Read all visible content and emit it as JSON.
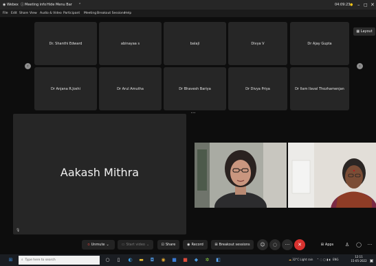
{
  "titlebar": {
    "items": [
      "Webex",
      "Meeting info",
      "Hide Menu Bar"
    ],
    "timer": "04:09:23",
    "minimize": "–",
    "restore": "◻",
    "close": "✕"
  },
  "menubar": {
    "items": [
      "File",
      "Edit",
      "Share",
      "View",
      "Audio & Video",
      "Participant",
      "Meeting",
      "Breakout Sessions",
      "Help"
    ]
  },
  "gallery": {
    "row1": [
      "Dr. Shanthi Edward",
      "abinayaa s",
      "balaji",
      "Divya V",
      "Dr Ajay Gupta"
    ],
    "row2": [
      "Dr Anjana R.Joshi",
      "Dr Arul Amutha",
      "Dr Bhavesh Bariya",
      "Dr Divya Priya",
      "Dr Ilam Ilaval Thozhamenjan"
    ],
    "layout_label": "Layout"
  },
  "main_speaker": {
    "name": "Aakash Mithra"
  },
  "controls": {
    "unmute": "Unmute",
    "start_video": "Start video",
    "share": "Share",
    "record": "Record",
    "breakout": "Breakout sessions",
    "apps": "Apps"
  },
  "taskbar": {
    "search_placeholder": "Type here to search",
    "weather": "32°C Light rain",
    "lang": "ENG",
    "time": "12:11",
    "date": "15-05-2022"
  },
  "colors": {
    "background": "#0d0d0d",
    "tile": "#262626",
    "end_button": "#d8322f"
  }
}
